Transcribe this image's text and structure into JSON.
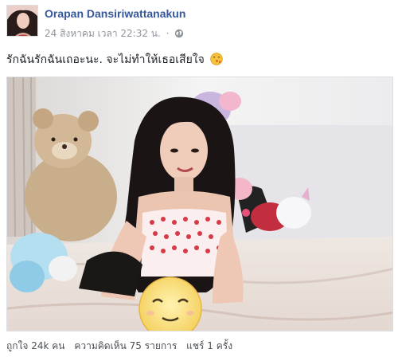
{
  "post": {
    "author": "Orapan Dansiriwattanakun",
    "date": "24 สิงหาคม เวลา 22:32 น.",
    "separator": "·",
    "privacy_icon": "globe-icon",
    "caption": "รักฉันรักฉันเถอะนะ. จะไม่ทำให้เธอเสียใจ",
    "caption_emoji": "kiss-emoji",
    "stats": {
      "likes": "ถูกใจ 24k คน",
      "comments": "ความคิดเห็น 75 รายการ",
      "shares": "แชร์ 1 ครั้ง"
    }
  },
  "colors": {
    "author_link": "#365899",
    "meta_text": "#90949c",
    "body_text": "#1d2129"
  }
}
